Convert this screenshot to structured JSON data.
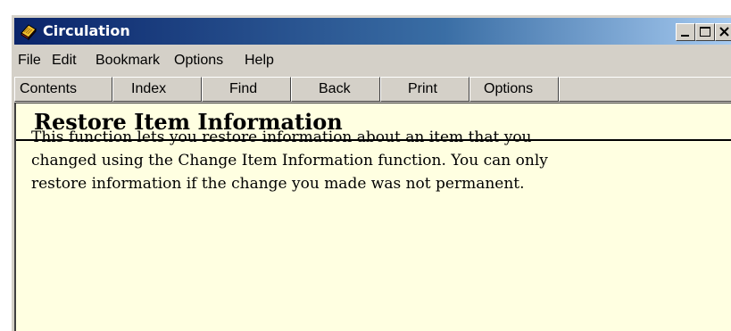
{
  "window": {
    "title": "Circulation",
    "minimize_icon": "minimize-icon",
    "maximize_icon": "maximize-icon",
    "close_icon": "close-icon",
    "app_icon": "help-book-icon"
  },
  "menubar": {
    "items": [
      "File",
      "Edit",
      "Bookmark",
      "Options",
      "Help"
    ]
  },
  "toolbar": {
    "buttons": [
      "Contents",
      "Index",
      "Find",
      "Back",
      "Print",
      "Options"
    ]
  },
  "content": {
    "heading": "Restore Item Information",
    "paragraph_lines": [
      "This function lets you restore information about an item that you",
      "changed using the Change Item Information function. You can only",
      "restore information if the change you made was not permanent."
    ]
  },
  "colors": {
    "titlebar_start": "#0a246a",
    "titlebar_end": "#a6caf0",
    "content_background": "#ffffe1",
    "window_face": "#d4d0c8"
  }
}
